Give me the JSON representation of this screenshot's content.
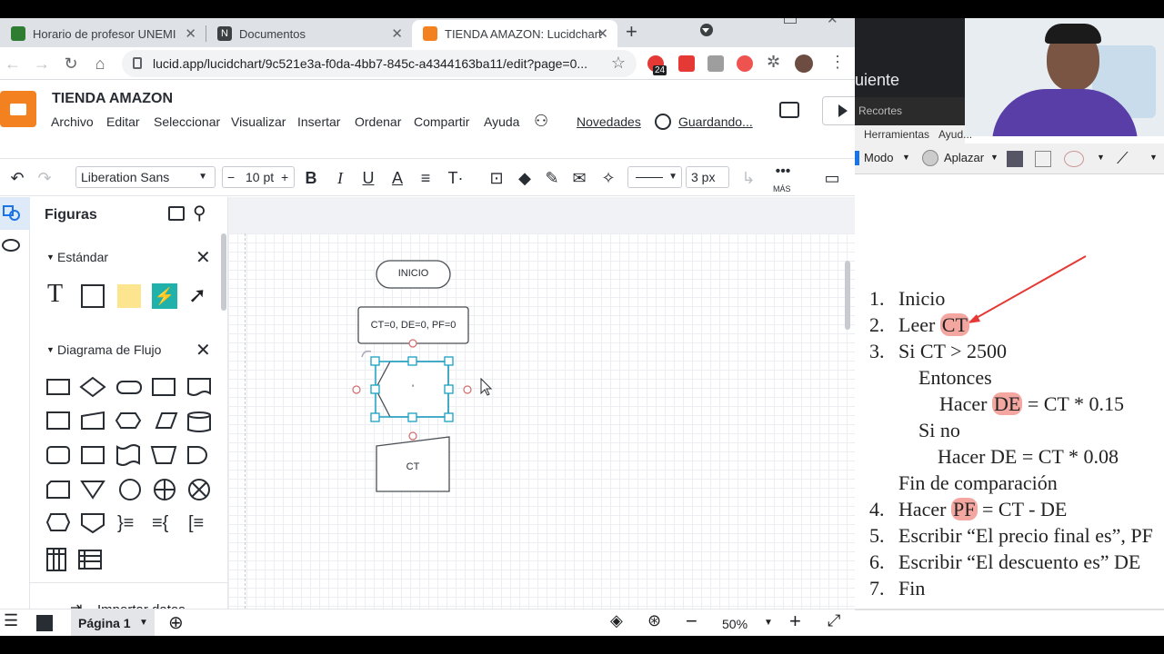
{
  "browser": {
    "tabs": [
      {
        "title": "Horario de profesor UNEMI",
        "active": false
      },
      {
        "title": "Documentos",
        "active": false
      },
      {
        "title": "TIENDA AMAZON: Lucidchart",
        "active": true
      }
    ],
    "url": "lucid.app/lucidchart/9c521e3a-f0da-4bb7-845c-a4344163ba11/edit?page=0...",
    "ext_badge": "24"
  },
  "lucid": {
    "doc_title": "TIENDA AMAZON",
    "menu": [
      "Archivo",
      "Editar",
      "Seleccionar",
      "Visualizar",
      "Insertar",
      "Ordenar",
      "Compartir",
      "Ayuda"
    ],
    "novedades": "Novedades",
    "saving": "Guardando...",
    "toolbar": {
      "font": "Liberation Sans",
      "font_size": "10 pt",
      "minus": "−",
      "plus": "+",
      "stroke_width": "3 px",
      "more": "MÁS"
    },
    "panel": {
      "title": "Figuras",
      "standard": "Estándar",
      "flowchart": "Diagrama de Flujo",
      "import": "Importar datos"
    },
    "canvas": {
      "start": "INICIO",
      "process": "CT=0,  DE=0, PF=0",
      "prep_text": "'",
      "input": "CT"
    },
    "bottom": {
      "page": "Página 1",
      "zoom": "50%"
    }
  },
  "right": {
    "dark_text": "uiente",
    "recortes": "Recortes",
    "menu": [
      "Herramientas",
      "Ayud..."
    ],
    "modo": "Modo",
    "aplazar": "Aplazar",
    "lines": [
      {
        "num": "1.",
        "text": "Inicio"
      },
      {
        "num": "2.",
        "pre": "Leer ",
        "hl": "CT",
        "post": ""
      },
      {
        "num": "3.",
        "text": "Si CT > 2500"
      },
      {
        "num": "",
        "text": "Entonces"
      },
      {
        "num": "",
        "pre": "Hacer ",
        "hl": "DE",
        "post": " = CT * 0.15"
      },
      {
        "num": "",
        "text": "Si no"
      },
      {
        "num": "",
        "text": "Hacer DE = CT * 0.08"
      },
      {
        "num": "",
        "text": "Fin de comparación"
      },
      {
        "num": "4.",
        "pre": "Hacer ",
        "hl": "PF",
        "post": " = CT - DE"
      },
      {
        "num": "5.",
        "text": "Escribir “El precio final es”, PF"
      },
      {
        "num": "6.",
        "text": "Escribir “El descuento es” DE"
      },
      {
        "num": "7.",
        "text": "Fin"
      }
    ]
  }
}
